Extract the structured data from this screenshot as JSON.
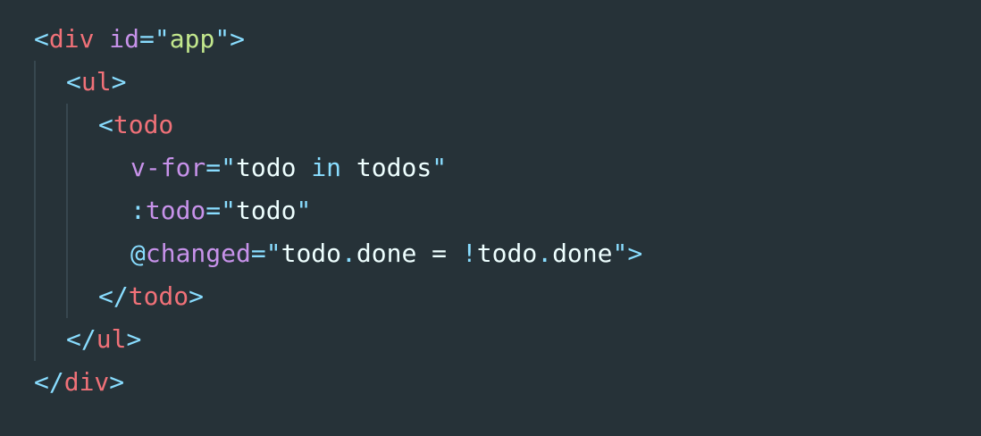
{
  "colors": {
    "background": "#263238",
    "punctuation": "#89ddff",
    "tag": "#f07178",
    "attribute": "#c792ea",
    "string": "#c3e88d",
    "text": "#eeffff",
    "indent_guide": "#37474f"
  },
  "code": {
    "lines": [
      {
        "tokens": [
          {
            "type": "punct",
            "text": "<"
          },
          {
            "type": "tag",
            "text": "div"
          },
          {
            "type": "text",
            "text": " "
          },
          {
            "type": "attr",
            "text": "id"
          },
          {
            "type": "punct",
            "text": "=\""
          },
          {
            "type": "str",
            "text": "app"
          },
          {
            "type": "punct",
            "text": "\">"
          }
        ]
      },
      {
        "tokens": [
          {
            "type": "punct",
            "text": "<"
          },
          {
            "type": "tag",
            "text": "ul"
          },
          {
            "type": "punct",
            "text": ">"
          }
        ]
      },
      {
        "tokens": [
          {
            "type": "punct",
            "text": "<"
          },
          {
            "type": "tag",
            "text": "todo"
          }
        ]
      },
      {
        "tokens": [
          {
            "type": "attr",
            "text": "v-for"
          },
          {
            "type": "punct",
            "text": "=\""
          },
          {
            "type": "text",
            "text": "todo "
          },
          {
            "type": "kw",
            "text": "in"
          },
          {
            "type": "text",
            "text": " todos"
          },
          {
            "type": "punct",
            "text": "\""
          }
        ]
      },
      {
        "tokens": [
          {
            "type": "punct",
            "text": ":"
          },
          {
            "type": "attr",
            "text": "todo"
          },
          {
            "type": "punct",
            "text": "=\""
          },
          {
            "type": "text",
            "text": "todo"
          },
          {
            "type": "punct",
            "text": "\""
          }
        ]
      },
      {
        "tokens": [
          {
            "type": "punct",
            "text": "@"
          },
          {
            "type": "attr",
            "text": "changed"
          },
          {
            "type": "punct",
            "text": "=\""
          },
          {
            "type": "text",
            "text": "todo"
          },
          {
            "type": "punct",
            "text": "."
          },
          {
            "type": "text",
            "text": "done = "
          },
          {
            "type": "punct",
            "text": "!"
          },
          {
            "type": "text",
            "text": "todo"
          },
          {
            "type": "punct",
            "text": "."
          },
          {
            "type": "text",
            "text": "done"
          },
          {
            "type": "punct",
            "text": "\">"
          }
        ]
      },
      {
        "tokens": [
          {
            "type": "punct",
            "text": "</"
          },
          {
            "type": "tag",
            "text": "todo"
          },
          {
            "type": "punct",
            "text": ">"
          }
        ]
      },
      {
        "tokens": [
          {
            "type": "punct",
            "text": "</"
          },
          {
            "type": "tag",
            "text": "ul"
          },
          {
            "type": "punct",
            "text": ">"
          }
        ]
      },
      {
        "tokens": [
          {
            "type": "punct",
            "text": "</"
          },
          {
            "type": "tag",
            "text": "div"
          },
          {
            "type": "punct",
            "text": ">"
          }
        ]
      }
    ]
  }
}
